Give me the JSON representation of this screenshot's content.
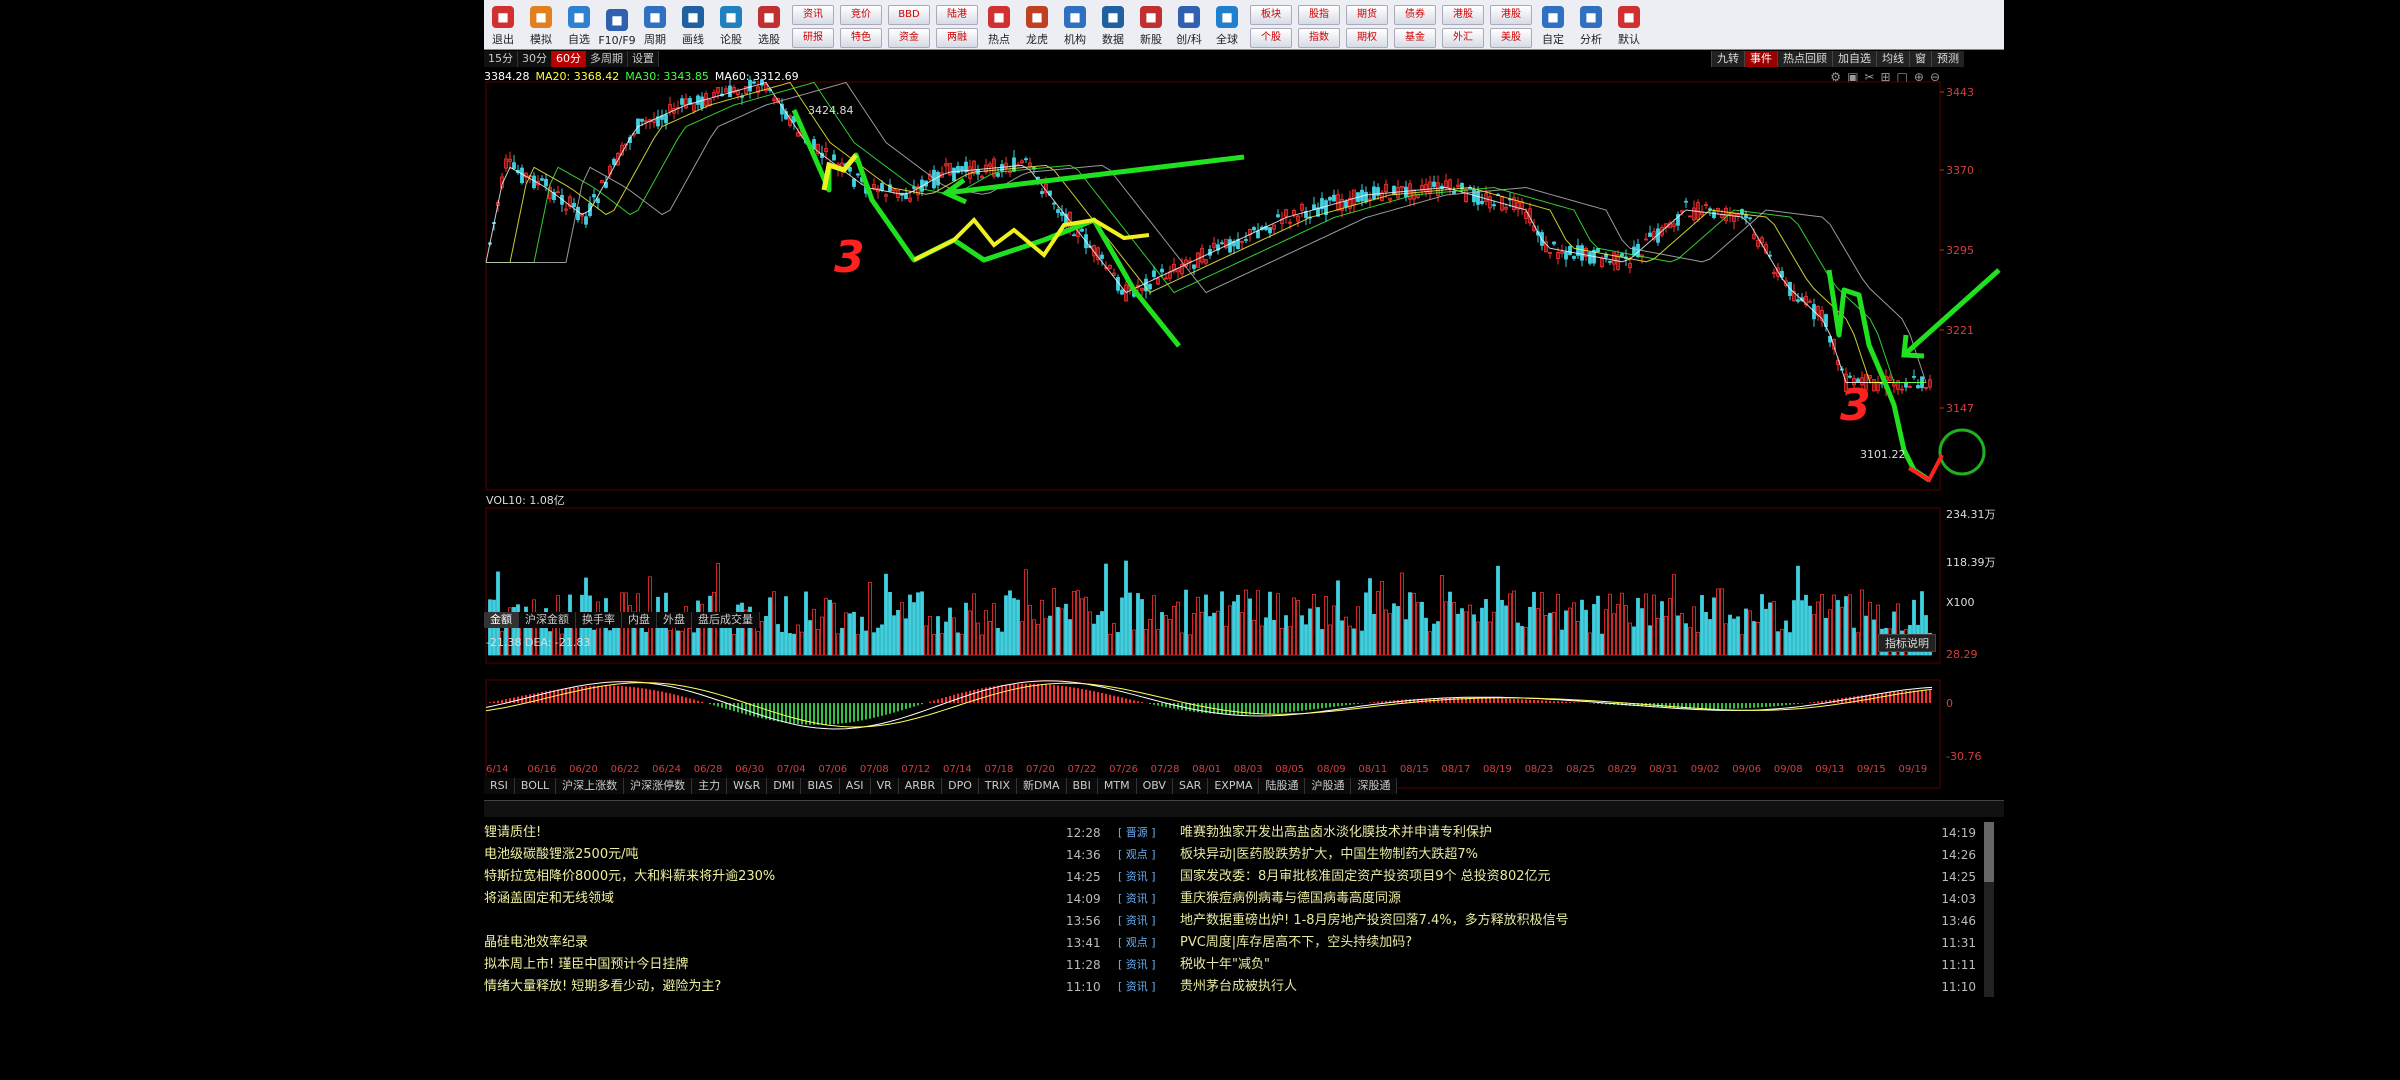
{
  "toolbar": {
    "buttons": [
      {
        "label": "退出",
        "color": "#d03030"
      },
      {
        "label": "模拟",
        "color": "#e08020"
      },
      {
        "label": "自选",
        "color": "#3080d0"
      },
      {
        "label": "F10/F9",
        "color": "#3060b0"
      },
      {
        "label": "周期",
        "color": "#3070c0"
      },
      {
        "label": "画线",
        "color": "#2060a0"
      },
      {
        "label": "论股",
        "color": "#2080c0"
      },
      {
        "label": "选股",
        "color": "#c03030"
      }
    ],
    "quick_buttons": [
      {
        "top": "资讯",
        "bottom": "研报"
      },
      {
        "top": "竞价",
        "bottom": "特色"
      },
      {
        "top": "BBD",
        "bottom": "资金"
      },
      {
        "top": "陆港",
        "bottom": "两融"
      }
    ],
    "buttons2": [
      {
        "label": "热点",
        "color": "#d03030"
      },
      {
        "label": "龙虎",
        "color": "#c04020"
      },
      {
        "label": "机构",
        "color": "#3070c0"
      },
      {
        "label": "数据",
        "color": "#2060a0"
      },
      {
        "label": "新股",
        "color": "#c03030"
      },
      {
        "label": "创/科",
        "color": "#3060b0"
      },
      {
        "label": "全球",
        "color": "#2080d0"
      }
    ],
    "quick_buttons2": [
      {
        "top": "板块",
        "bottom": "个股"
      },
      {
        "top": "股指",
        "bottom": "指数"
      },
      {
        "top": "期货",
        "bottom": "期权"
      },
      {
        "top": "债券",
        "bottom": "基金"
      },
      {
        "top": "港股",
        "bottom": "外汇"
      },
      {
        "top": "港股",
        "bottom": "美股"
      }
    ],
    "buttons3": [
      {
        "label": "自定",
        "color": "#3070c0"
      },
      {
        "label": "分析",
        "color": "#3070c0"
      },
      {
        "label": "默认",
        "color": "#d03030"
      }
    ]
  },
  "period_tabs": [
    "15分",
    "30分",
    "60分",
    "多周期",
    "设置"
  ],
  "period_active": 2,
  "ma_row": [
    {
      "text": "3384.28",
      "color": "#ffffff"
    },
    {
      "text": "MA20: 3368.42",
      "color": "#ffff40"
    },
    {
      "text": "MA30: 3343.85",
      "color": "#40ff40"
    },
    {
      "text": "MA60: 3312.69",
      "color": "#ffffff"
    }
  ],
  "right_tabs": [
    "九转",
    "事件",
    "热点回顾",
    "加自选",
    "均线",
    "窗",
    "预测"
  ],
  "price_chart": {
    "y_ticks": [
      "3443",
      "3370",
      "3295",
      "3221",
      "3147"
    ],
    "high_label": "3424.84",
    "low_label": "3101.22",
    "annotation_digit": "3"
  },
  "volume_chart": {
    "label": "VOL10: 1.08亿",
    "y_ticks": [
      "234.31万",
      "118.39万",
      "X100"
    ]
  },
  "volume_tabs": [
    "金额",
    "沪深金额",
    "换手率",
    "内盘",
    "外盘",
    "盘后成交量"
  ],
  "macd_chart": {
    "label": "-21.38  DEA: -21.83",
    "button": "指标说明",
    "y_ticks": [
      "28.29",
      "0",
      "-30.76"
    ]
  },
  "dates": [
    "6/14",
    "06/16",
    "06/20",
    "06/22",
    "06/24",
    "06/28",
    "06/30",
    "07/04",
    "07/06",
    "07/08",
    "07/12",
    "07/14",
    "07/18",
    "07/20",
    "07/22",
    "07/26",
    "07/28",
    "08/01",
    "08/03",
    "08/05",
    "08/09",
    "08/11",
    "08/15",
    "08/17",
    "08/19",
    "08/23",
    "08/25",
    "08/29",
    "08/31",
    "09/02",
    "09/06",
    "09/08",
    "09/13",
    "09/15",
    "09/19"
  ],
  "indicator_tabs": [
    "RSI",
    "BOLL",
    "沪深上涨数",
    "沪深涨停数",
    "主力",
    "W&R",
    "DMI",
    "BIAS",
    "ASI",
    "VR",
    "ARBR",
    "DPO",
    "TRIX",
    "新DMA",
    "BBI",
    "MTM",
    "OBV",
    "SAR",
    "EXPMA",
    "陆股通",
    "沪股通",
    "深股通"
  ],
  "news_left": [
    "锂请质住!",
    "电池级碳酸锂涨2500元/吨",
    "特斯拉宽相降价8000元，大和料薪来将升逾230%",
    "将涵盖固定和无线领域",
    "",
    "晶硅电池效率纪录",
    "拟本周上市! 瑾臣中国预计今日挂牌",
    "情绪大量释放! 短期多看少动，避险为主?"
  ],
  "news_right": [
    {
      "time1": "12:28",
      "tag": "晋源",
      "title": "唯赛勃独家开发出高盐卤水淡化膜技术并申请专利保护",
      "time2": "14:19"
    },
    {
      "time1": "14:36",
      "tag": "观点",
      "title": "板块异动|医药股跌势扩大，中国生物制药大跌超7%",
      "time2": "14:26"
    },
    {
      "time1": "14:25",
      "tag": "资讯",
      "title": "国家发改委：8月审批核准固定资产投资项目9个 总投资802亿元",
      "time2": "14:25"
    },
    {
      "time1": "14:09",
      "tag": "资讯",
      "title": "重庆猴痘病例病毒与德国病毒高度同源",
      "time2": "14:03"
    },
    {
      "time1": "13:56",
      "tag": "资讯",
      "title": "地产数据重磅出炉! 1-8月房地产投资回落7.4%，多方释放积极信号",
      "time2": "13:46"
    },
    {
      "time1": "13:41",
      "tag": "观点",
      "title": "PVC周度|库存居高不下，空头持续加码?",
      "time2": "11:31"
    },
    {
      "time1": "11:28",
      "tag": "资讯",
      "title": "税收十年\"减负\"",
      "time2": "11:11"
    },
    {
      "time1": "11:10",
      "tag": "资讯",
      "title": "贵州茅台成被执行人",
      "time2": "11:10"
    }
  ]
}
